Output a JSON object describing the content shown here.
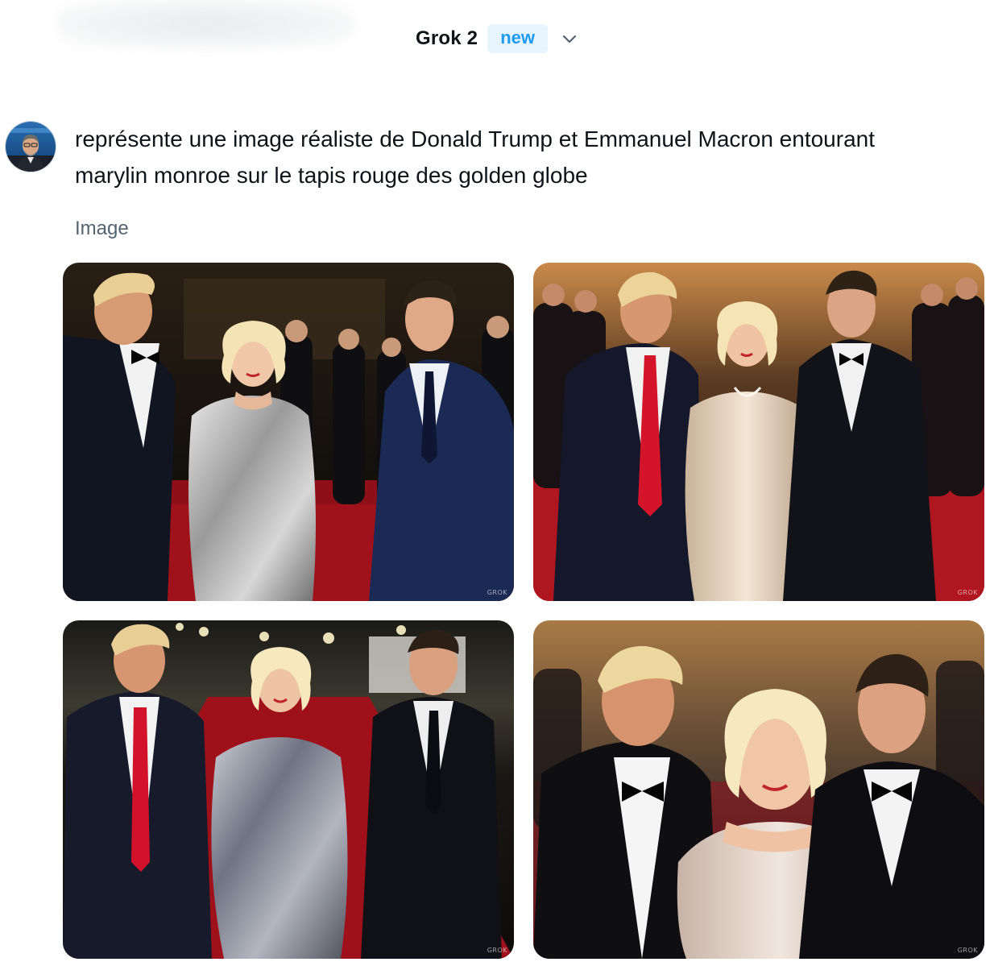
{
  "header": {
    "model_name": "Grok 2",
    "badge": "new",
    "dropdown_icon": "chevron-down-icon"
  },
  "message": {
    "avatar_icon": "user-avatar",
    "prompt_line1": "représente une image réaliste de Donald Trump et Emmanuel Macron entourant",
    "prompt_line2": "marylin monroe sur le tapis rouge des golden globe"
  },
  "result": {
    "section_label": "Image",
    "watermark": "GROK"
  },
  "colors": {
    "accent": "#1d9bf0",
    "badge_bg": "#e8f4fd",
    "text": "#0f1419",
    "muted": "#536471",
    "carpet": "#b3121b"
  }
}
